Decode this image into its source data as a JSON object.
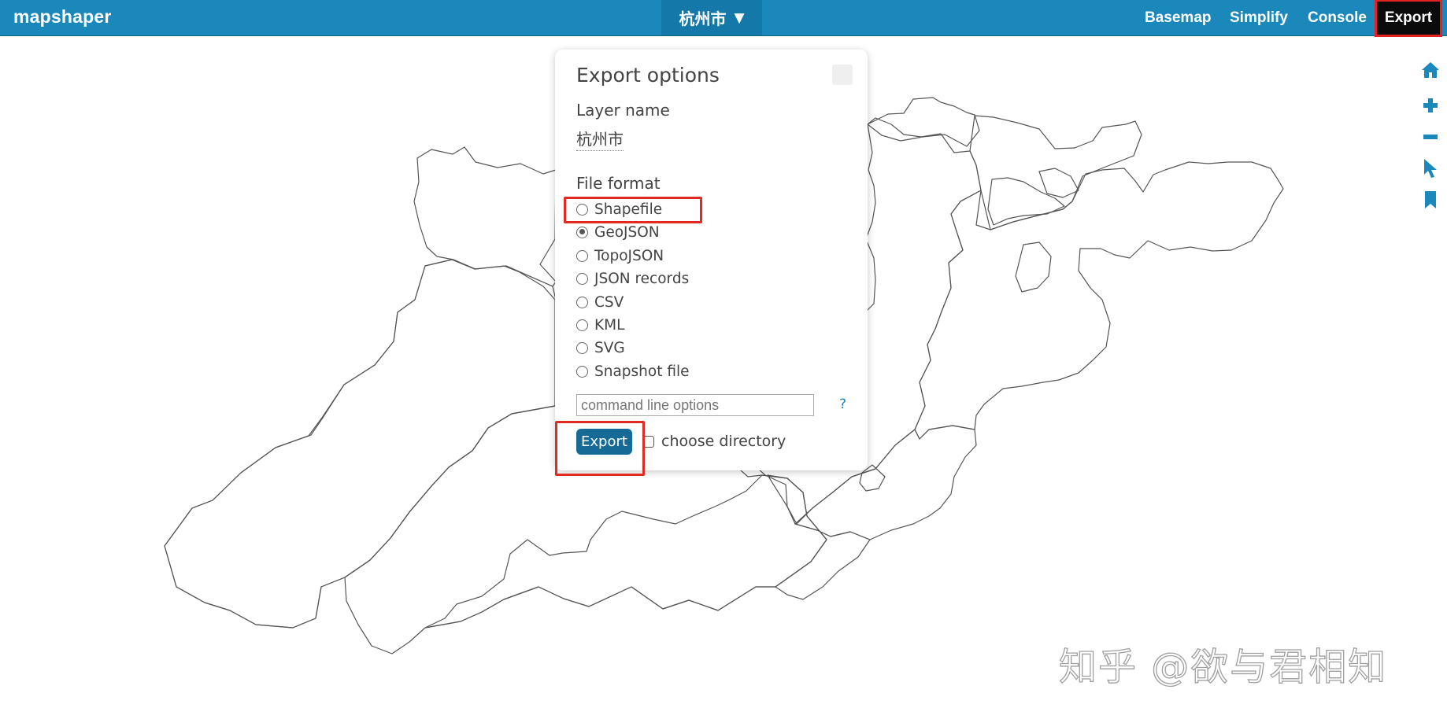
{
  "app": {
    "name": "mapshaper"
  },
  "topbar": {
    "layer_menu": {
      "label": "杭州市",
      "caret": "▼"
    },
    "nav": [
      "Basemap",
      "Simplify",
      "Console",
      "Export"
    ],
    "active": "Export"
  },
  "map_tools": [
    "home-icon",
    "zoom-in-icon",
    "zoom-out-icon",
    "pointer-icon",
    "bookmark-icon"
  ],
  "export_panel": {
    "title": "Export options",
    "layer_name_label": "Layer name",
    "layer_name_value": "杭州市",
    "file_format_label": "File format",
    "formats": [
      {
        "label": "Shapefile",
        "selected": false
      },
      {
        "label": "GeoJSON",
        "selected": true
      },
      {
        "label": "TopoJSON",
        "selected": false
      },
      {
        "label": "JSON records",
        "selected": false
      },
      {
        "label": "CSV",
        "selected": false
      },
      {
        "label": "KML",
        "selected": false
      },
      {
        "label": "SVG",
        "selected": false
      },
      {
        "label": "Snapshot file",
        "selected": false
      }
    ],
    "command_line_placeholder": "command line options",
    "help_label": "?",
    "export_button": "Export",
    "choose_directory_label": "choose directory"
  },
  "watermark": "知乎 @欲与君相知",
  "colors": {
    "topbar": "#1b88bc",
    "layer_menu_bg": "#1478a8",
    "active_tab_bg": "#0b0b0b",
    "highlight": "#e02a22",
    "export_button": "#156a96",
    "map_line": "#555555",
    "tool_icon": "#1b88bc"
  }
}
